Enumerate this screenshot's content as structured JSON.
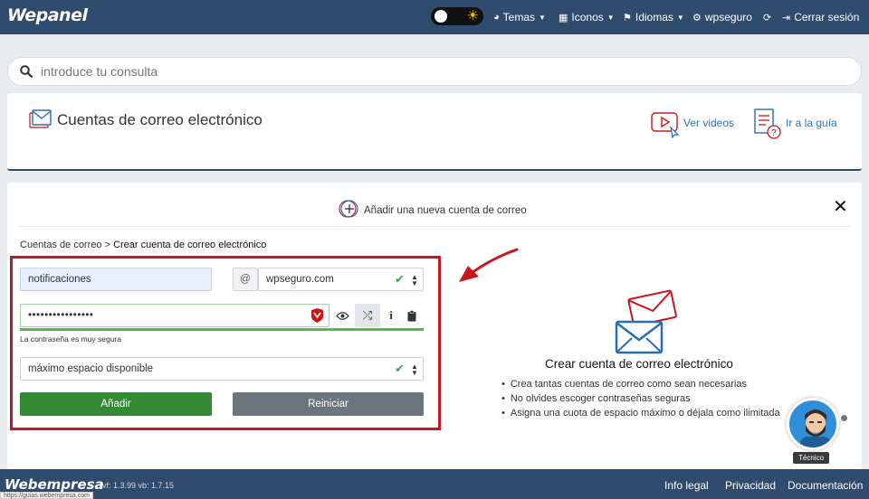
{
  "app": {
    "logo": "Wepanel"
  },
  "topnav": {
    "themes": "Temas",
    "icons": "Iconos",
    "languages": "Idiomas",
    "user": "wpseguro",
    "logout": "Cerrar sesión"
  },
  "search": {
    "placeholder": "introduce tu consulta"
  },
  "header": {
    "title": "Cuentas de correo electrónico",
    "videos": "Ver videos",
    "guide": "Ir a la guía"
  },
  "form": {
    "add_new": "Añadir una nueva cuenta de correo",
    "breadcrumb_parent": "Cuentas de correo",
    "breadcrumb_sep": ">",
    "breadcrumb_current": "Crear cuenta de correo electrónico",
    "username": "notificaciones",
    "at": "@",
    "domain": "wpseguro.com",
    "password_mask": "••••••••••••••••",
    "password_message": "La contraseña es muy segura",
    "password_strength": 1.0,
    "quota": "máximo espacio disponible",
    "add_button": "Añadir",
    "reset_button": "Reiniciar"
  },
  "info": {
    "title": "Crear cuenta de correo electrónico",
    "tips": [
      "Crea tantas cuentas de correo como sean necesarias",
      "No olvides escoger contraseñas seguras",
      "Asigna una cuota de espacio máximo o déjala como ilimitada"
    ]
  },
  "support": {
    "label": "Técnico"
  },
  "footer": {
    "logo": "Webempresa",
    "version": "vf: 1.3.99 vb: 1.7.15",
    "legal": "Info legal",
    "privacy": "Privacidad",
    "docs": "Documentación",
    "status_url": "https://guias.webempresa.com"
  },
  "colors": {
    "navbar": "#2f4b6e",
    "highlight": "#c8161d",
    "primary_button": "#348a34",
    "secondary_button": "#6c757d",
    "link": "#2a73c5"
  }
}
